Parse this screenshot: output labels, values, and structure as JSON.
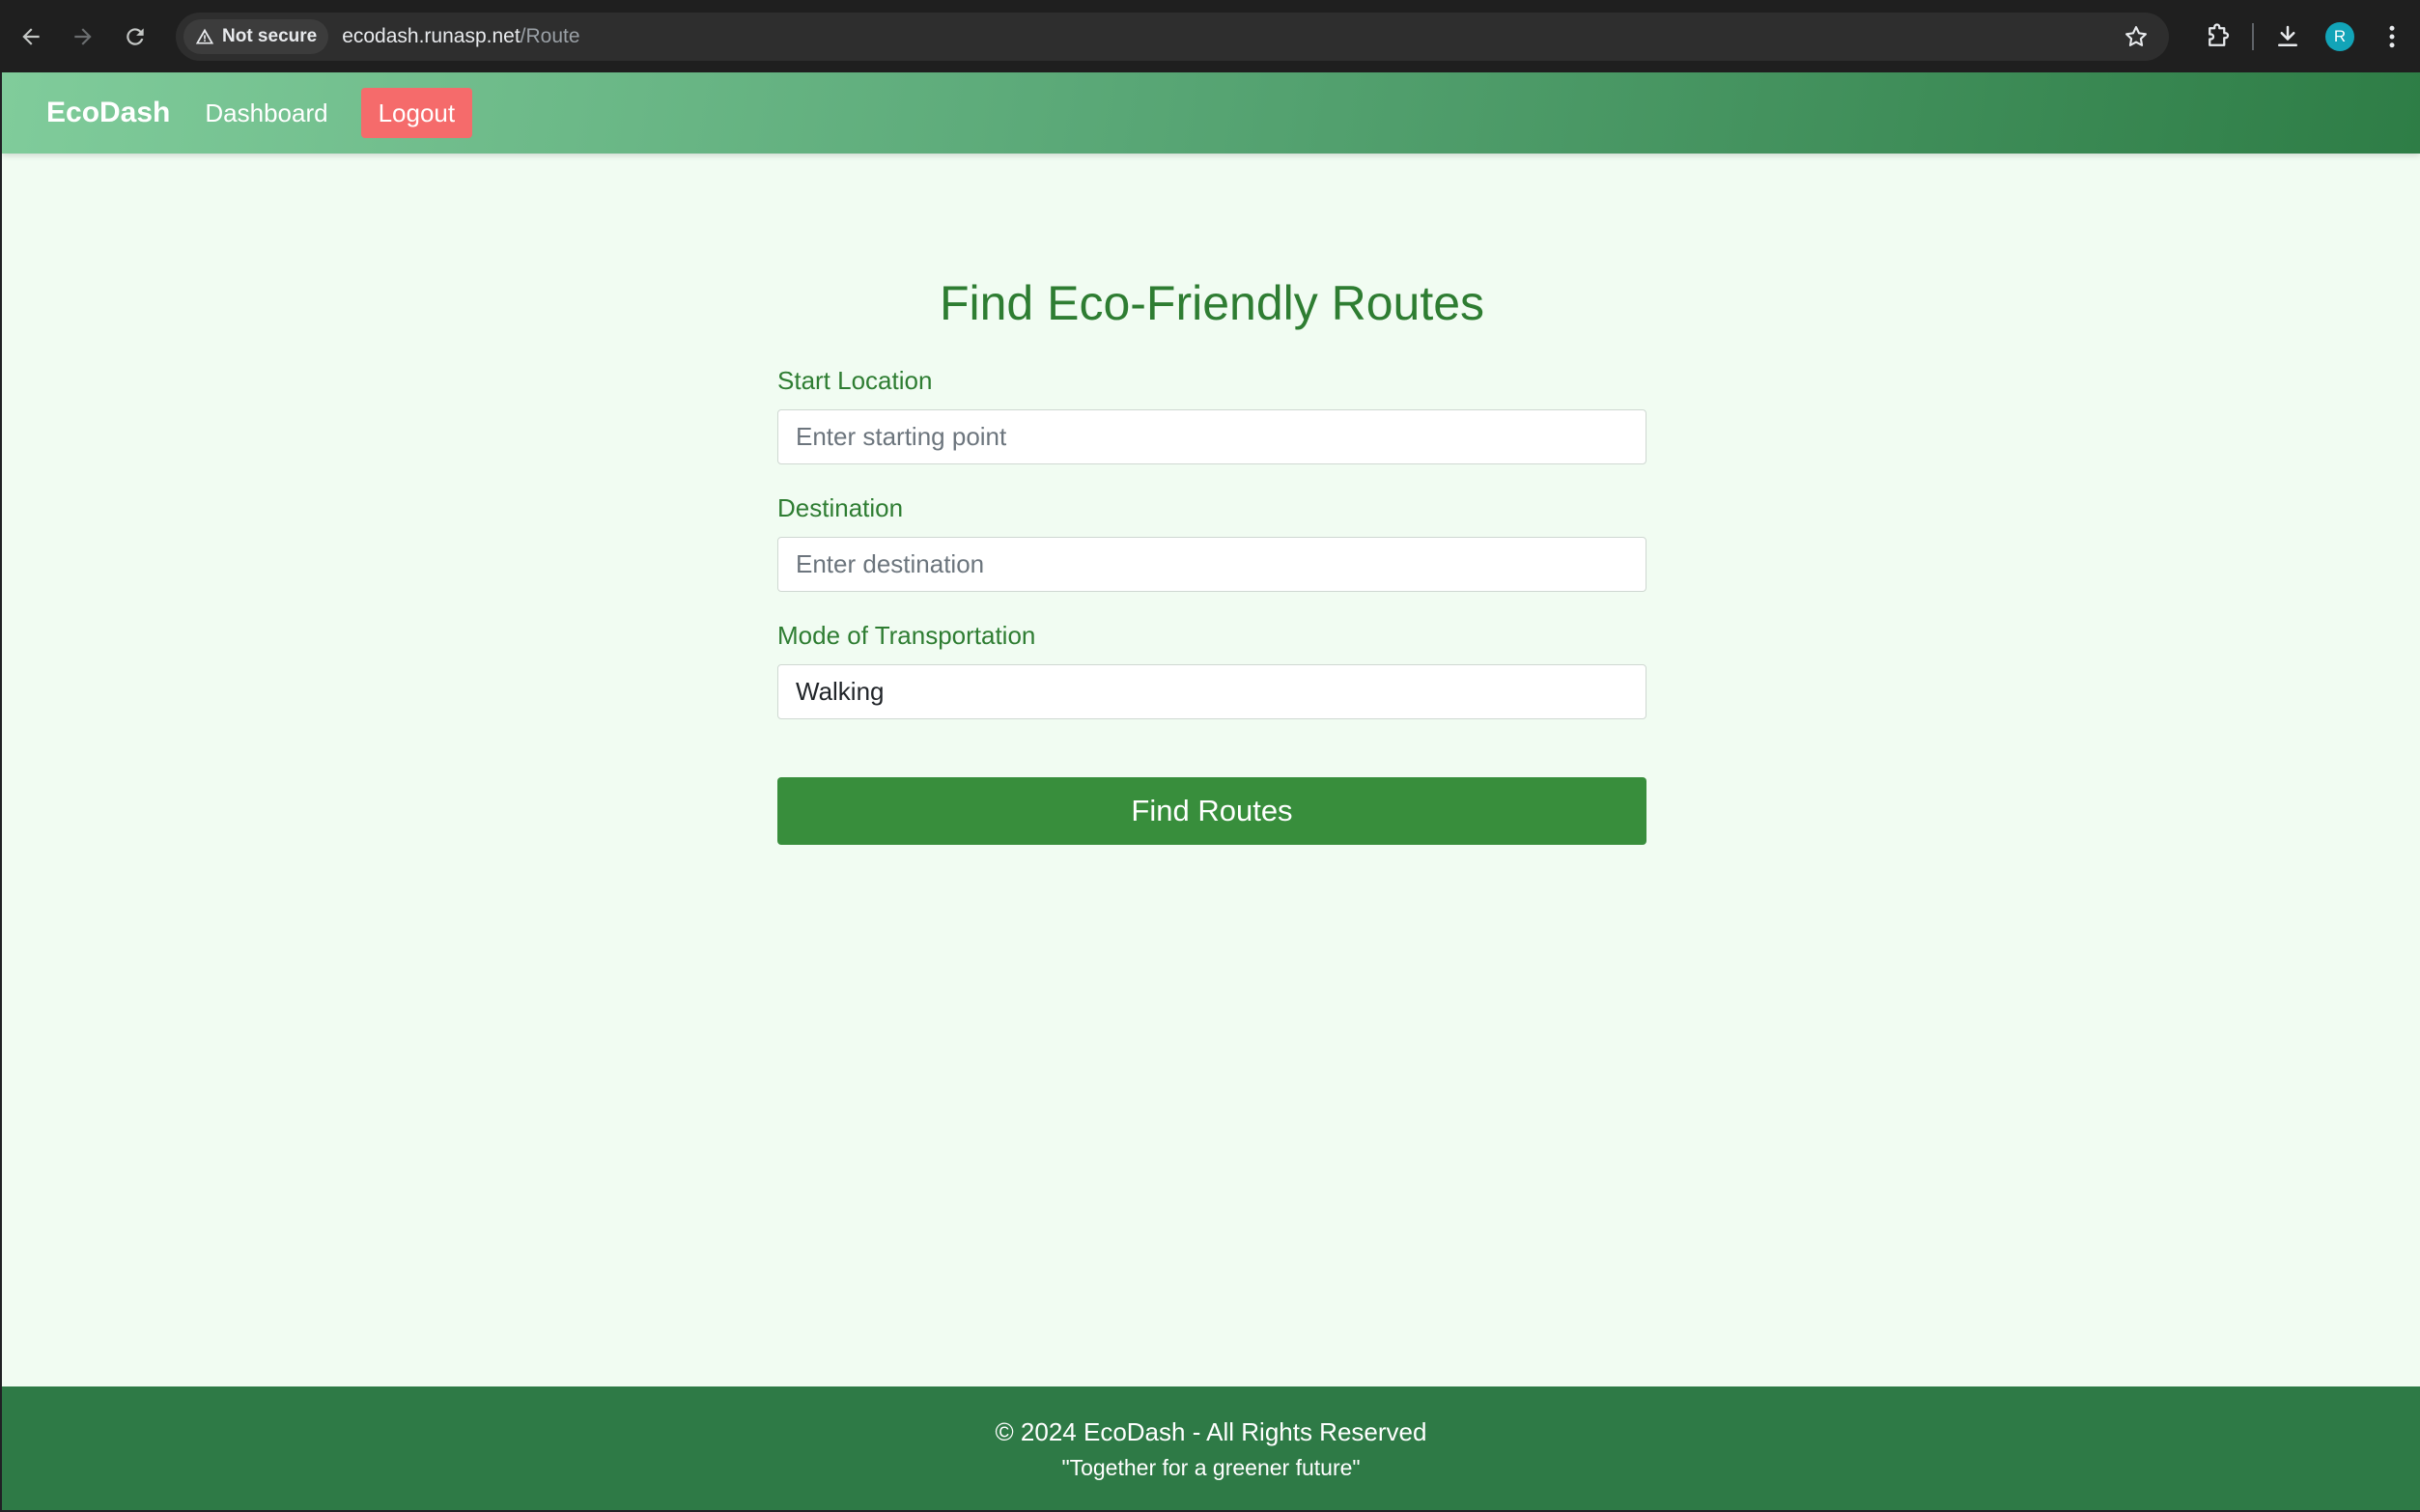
{
  "browser": {
    "security_label": "Not secure",
    "url_host": "ecodash.runasp.net",
    "url_path": "/Route",
    "profile_initial": "R"
  },
  "navbar": {
    "brand": "EcoDash",
    "dashboard_link": "Dashboard",
    "logout_label": "Logout"
  },
  "form": {
    "title": "Find Eco-Friendly Routes",
    "start_label": "Start Location",
    "start_placeholder": "Enter starting point",
    "destination_label": "Destination",
    "destination_placeholder": "Enter destination",
    "mode_label": "Mode of Transportation",
    "mode_selected": "Walking",
    "submit_label": "Find Routes"
  },
  "footer": {
    "copyright": "© 2024 EcoDash - All Rights Reserved",
    "tagline": "\"Together for a greener future\""
  },
  "colors": {
    "accent_green": "#2e7d32",
    "button_green": "#388e3c",
    "logout_red": "#f56b6b",
    "footer_green": "#2e7a46",
    "page_background": "#f1fcf2"
  },
  "icons": [
    "back-arrow-icon",
    "forward-arrow-icon",
    "reload-icon",
    "warning-icon",
    "star-icon",
    "extensions-icon",
    "download-icon",
    "more-vert-icon"
  ]
}
